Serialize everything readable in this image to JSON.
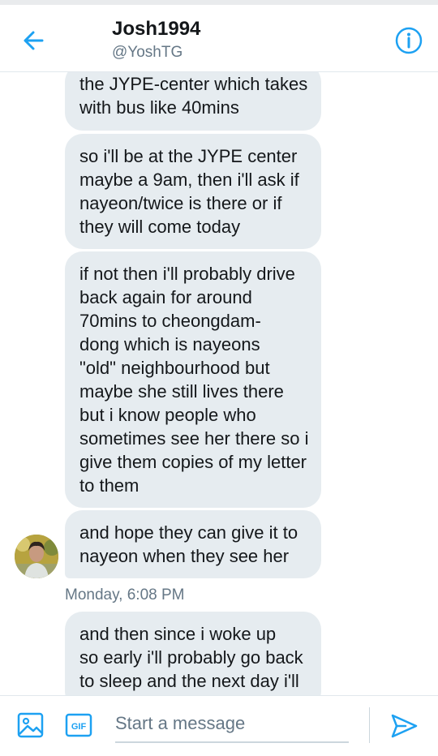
{
  "header": {
    "name": "Josh1994",
    "handle": "@YoshTG"
  },
  "conversation": {
    "messages": [
      {
        "lines": [
          "the JYPE-center which takes",
          "with bus like 40mins"
        ]
      },
      {
        "lines": [
          "so i'll be at the JYPE center",
          "maybe a 9am, then i'll ask if",
          "nayeon/twice is there or if",
          "they will come today"
        ]
      },
      {
        "lines": [
          "if not then i'll probably drive",
          "back again for around",
          "70mins to cheongdam-",
          "dong which is nayeons",
          "\"old\" neighbourhood but",
          "maybe she still lives there",
          "but i know people who",
          "sometimes see her there so i",
          "give them copies of my letter",
          "to them"
        ]
      },
      {
        "lines": [
          "and hope they can give it to",
          "nayeon when they see her"
        ]
      },
      {
        "lines": [
          "and  then since i woke up",
          "so early i'll probably go back",
          "to sleep and the next day i'll"
        ]
      }
    ],
    "timestamp": "Monday, 6:08 PM"
  },
  "composer": {
    "placeholder": "Start a message",
    "gif_label": "GIF"
  },
  "colors": {
    "accent": "#1da1f2",
    "bubble": "#e6ecf0",
    "secondary_text": "#657786"
  },
  "icons": {
    "back": "arrow-left-icon",
    "info": "info-icon",
    "media": "image-icon",
    "gif": "gif-icon",
    "send": "send-icon"
  }
}
